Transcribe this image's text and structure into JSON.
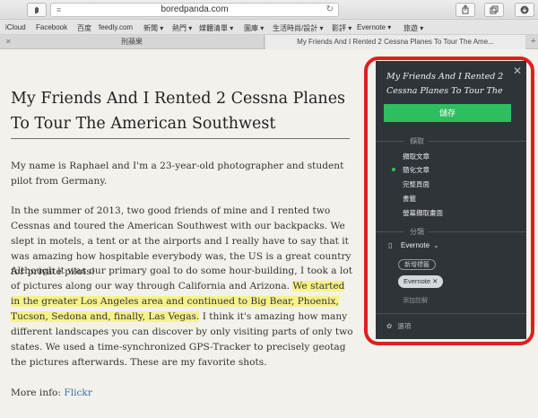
{
  "browser": {
    "url": "boredpanda.com",
    "lines_icon": "≡",
    "reload_icon": "↻",
    "bookmarks": [
      "iCloud",
      "Facebook",
      "百度",
      "feedly.com",
      "新聞 ▾",
      "熱門 ▾",
      "媒體清單 ▾",
      "圖庫 ▾",
      "生活時尚/設計 ▾",
      "影評 ▾",
      "Evernote ▾",
      "旅遊 ▾"
    ],
    "tabs": [
      {
        "label": "刑蘋果",
        "close": "✕"
      },
      {
        "label": "My Friends And I Rented 2 Cessna Planes To Tour The Ame..."
      }
    ],
    "new_tab": "+"
  },
  "article": {
    "title": "My Friends And I Rented 2 Cessna Planes To Tour The American Southwest",
    "p1": "My name is Raphael and I'm a 23-year-old photographer and student pilot from Germany.",
    "p2": "In the summer of 2013, two good friends of mine and I rented two Cessnas and toured the American Southwest with our backpacks. We slept in motels, a tent or at the airports and I really have to say that it was amazing how hospitable everybody was, the US is a great country for private pilots!",
    "p3_start": "Although it was our primary goal to do some hour-building, I took a lot of pictures along our way through California and Arizona. ",
    "p3_highlight": "We started in the greater Los Angeles area and continued to Big Bear, Phoenix, Tucson, Sedona and, finally, Las Vegas.",
    "p3_end": " I think it's amazing how many different landscapes you can discover by only visiting parts of only two states. We used a time-synchronized GPS-Tracker to precisely geotag the pictures afterwards. These are my favorite shots.",
    "more_info_label": "More info: ",
    "more_info_link": "Flickr"
  },
  "clipper": {
    "close": "✕",
    "title": "My Friends And I Rented 2 Cessna Planes To Tour The",
    "save": "儲存",
    "clip_section": "擷取",
    "clip_options": [
      "擷取文章",
      "簡化文章",
      "完整頁面",
      "書籤",
      "螢幕擷取畫面"
    ],
    "file_section": "分類",
    "notebook_icon": "▯",
    "notebook": "Evernote",
    "notebook_chevron": "⌄",
    "add_tag": "新增標籤",
    "tag": "Evernote ✕",
    "add_note": "添加註解",
    "settings_icon": "✿",
    "settings": "選項"
  },
  "colors": {
    "save_green": "#2dbe60",
    "panel_bg": "#2f3438",
    "outline_red": "#e0201f",
    "highlight": "#f6f28a"
  }
}
